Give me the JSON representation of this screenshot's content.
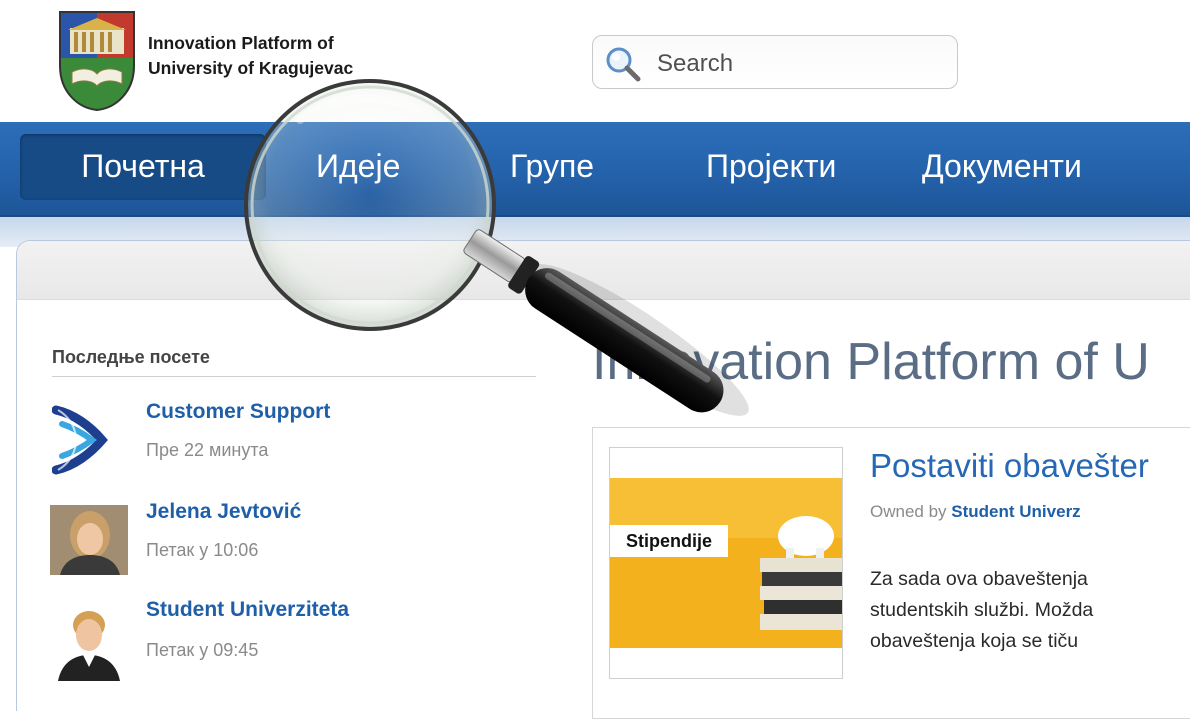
{
  "header": {
    "brand_line1": "Innovation Platform of",
    "brand_line2": "University of Kragujevac",
    "logo": "university-crest-icon"
  },
  "search": {
    "placeholder": "Search",
    "icon": "search-icon"
  },
  "nav": {
    "items": [
      {
        "label": "Почетна",
        "active": true
      },
      {
        "label": "Идеје"
      },
      {
        "label": "Групе"
      },
      {
        "label": "Пројекти"
      },
      {
        "label": "Документи"
      }
    ]
  },
  "sidebar": {
    "recent_heading": "Последње посете",
    "recent": [
      {
        "name": "Customer Support",
        "time": "Пре 22 минута",
        "icon": "support-logo-icon"
      },
      {
        "name": "Jelena Jevtović",
        "time": "Петак у 10:06",
        "icon": "avatar"
      },
      {
        "name": "Student Univerziteta",
        "time": "Петак у 09:45",
        "icon": "avatar"
      }
    ]
  },
  "main": {
    "title": "Innovation Platform of U",
    "post": {
      "title": "Postaviti obavešter",
      "owned_by_label": "Owned by",
      "owner": "Student Univerz",
      "thumbnail_label": "Stipendije",
      "lines": [
        "Za sada ova obaveštenja",
        "studentskih službi. Možda",
        "obaveštenja koja se tiču"
      ]
    }
  },
  "colors": {
    "nav_blue": "#2462ab",
    "nav_active": "#164b86",
    "link_blue": "#1f5fa8",
    "title_gray": "#5a6d85"
  }
}
